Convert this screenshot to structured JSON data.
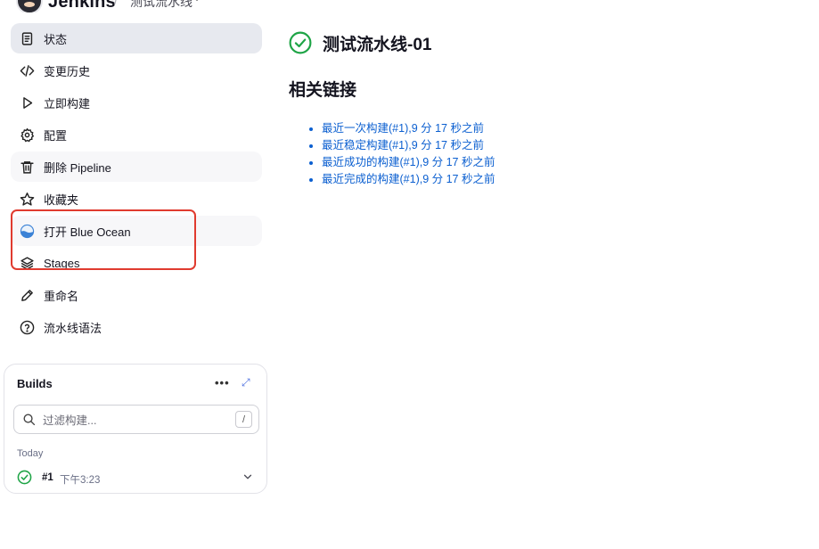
{
  "header": {
    "brand": "Jenkins",
    "separator": "/",
    "job_crumb": "测试流水线",
    "caret": "⌄"
  },
  "sidebar": {
    "items": [
      {
        "label": "状态",
        "icon": "document-icon"
      },
      {
        "label": "变更历史",
        "icon": "code-icon"
      },
      {
        "label": "立即构建",
        "icon": "play-icon"
      },
      {
        "label": "配置",
        "icon": "gear-icon"
      },
      {
        "label": "删除 Pipeline",
        "icon": "trash-icon"
      },
      {
        "label": "收藏夹",
        "icon": "star-icon"
      },
      {
        "label": "打开 Blue Ocean",
        "icon": "blue-ocean-icon"
      },
      {
        "label": "Stages",
        "icon": "stack-icon"
      },
      {
        "label": "重命名",
        "icon": "pencil-icon"
      },
      {
        "label": "流水线语法",
        "icon": "help-icon"
      }
    ]
  },
  "builds": {
    "title": "Builds",
    "more": "•••",
    "expand": "⤢",
    "filter_placeholder": "过滤构建...",
    "filter_value": "",
    "shortcut": "/",
    "group": "Today",
    "rows": [
      {
        "number": "#1",
        "time": "下午3:23",
        "status": "success"
      }
    ]
  },
  "main": {
    "title": "测试流水线-01",
    "related_heading": "相关链接",
    "links": [
      "最近一次构建(#1),9 分 17 秒之前",
      "最近稳定构建(#1),9 分 17 秒之前",
      "最近成功的构建(#1),9 分 17 秒之前",
      "最近完成的构建(#1),9 分 17 秒之前"
    ]
  },
  "colors": {
    "success": "#1ea446",
    "link": "#0b5fd0",
    "highlight": "#e03b2f",
    "active_bg": "#e7e9ef"
  }
}
